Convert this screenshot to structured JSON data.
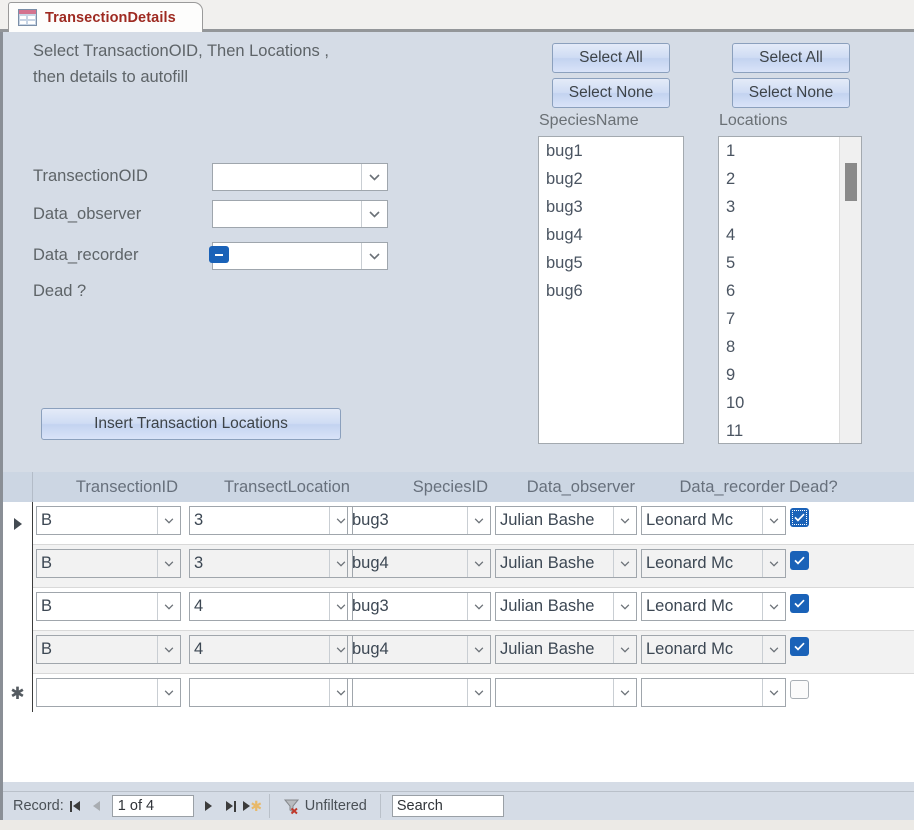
{
  "tab": {
    "label": "TransectionDetails",
    "icon": "form-datasheet-icon"
  },
  "form": {
    "instructions_line1": "Select TransactionOID, Then Locations ,",
    "instructions_line2": "then details to autofill",
    "fields": [
      {
        "label": "TransectionOID",
        "value": ""
      },
      {
        "label": "Data_observer",
        "value": ""
      },
      {
        "label": "Data_recorder",
        "value": ""
      }
    ],
    "dead_label": "Dead ?",
    "dead_state": "indeterminate",
    "insert_button": "Insert Transaction Locations"
  },
  "species_panel": {
    "select_all": "Select All",
    "select_none": "Select None",
    "caption": "SpeciesName",
    "items": [
      "bug1",
      "bug2",
      "bug3",
      "bug4",
      "bug5",
      "bug6"
    ]
  },
  "locations_panel": {
    "select_all": "Select All",
    "select_none": "Select None",
    "caption": "Locations",
    "items": [
      "1",
      "2",
      "3",
      "4",
      "5",
      "6",
      "7",
      "8",
      "9",
      "10",
      "11"
    ]
  },
  "datasheet": {
    "columns": [
      "TransectionID",
      "TransectLocation",
      "SpeciesID",
      "Data_observer",
      "Data_recorder",
      "Dead?"
    ],
    "rows": [
      {
        "selector": "current",
        "TransectionID": "B",
        "TransectLocation": "3",
        "SpeciesID": "bug3",
        "Data_observer": "Julian Bashe",
        "Data_recorder": "Leonard Mc",
        "Dead": "checked"
      },
      {
        "selector": "",
        "TransectionID": "B",
        "TransectLocation": "3",
        "SpeciesID": "bug4",
        "Data_observer": "Julian Bashe",
        "Data_recorder": "Leonard Mc",
        "Dead": "checked"
      },
      {
        "selector": "",
        "TransectionID": "B",
        "TransectLocation": "4",
        "SpeciesID": "bug3",
        "Data_observer": "Julian Bashe",
        "Data_recorder": "Leonard Mc",
        "Dead": "checked"
      },
      {
        "selector": "",
        "TransectionID": "B",
        "TransectLocation": "4",
        "SpeciesID": "bug4",
        "Data_observer": "Julian Bashe",
        "Data_recorder": "Leonard Mc",
        "Dead": "checked"
      },
      {
        "selector": "new",
        "TransectionID": "",
        "TransectLocation": "",
        "SpeciesID": "",
        "Data_observer": "",
        "Data_recorder": "",
        "Dead": "unchecked"
      }
    ]
  },
  "navbar": {
    "record_label": "Record:",
    "position": "1 of 4",
    "filter_status": "Unfiltered",
    "search_value": "Search"
  },
  "colors": {
    "form_background": "#d5dce6",
    "tab_text": "#9e2a21",
    "checkbox_blue": "#1a62b8",
    "header_background": "#ccd6e3"
  }
}
